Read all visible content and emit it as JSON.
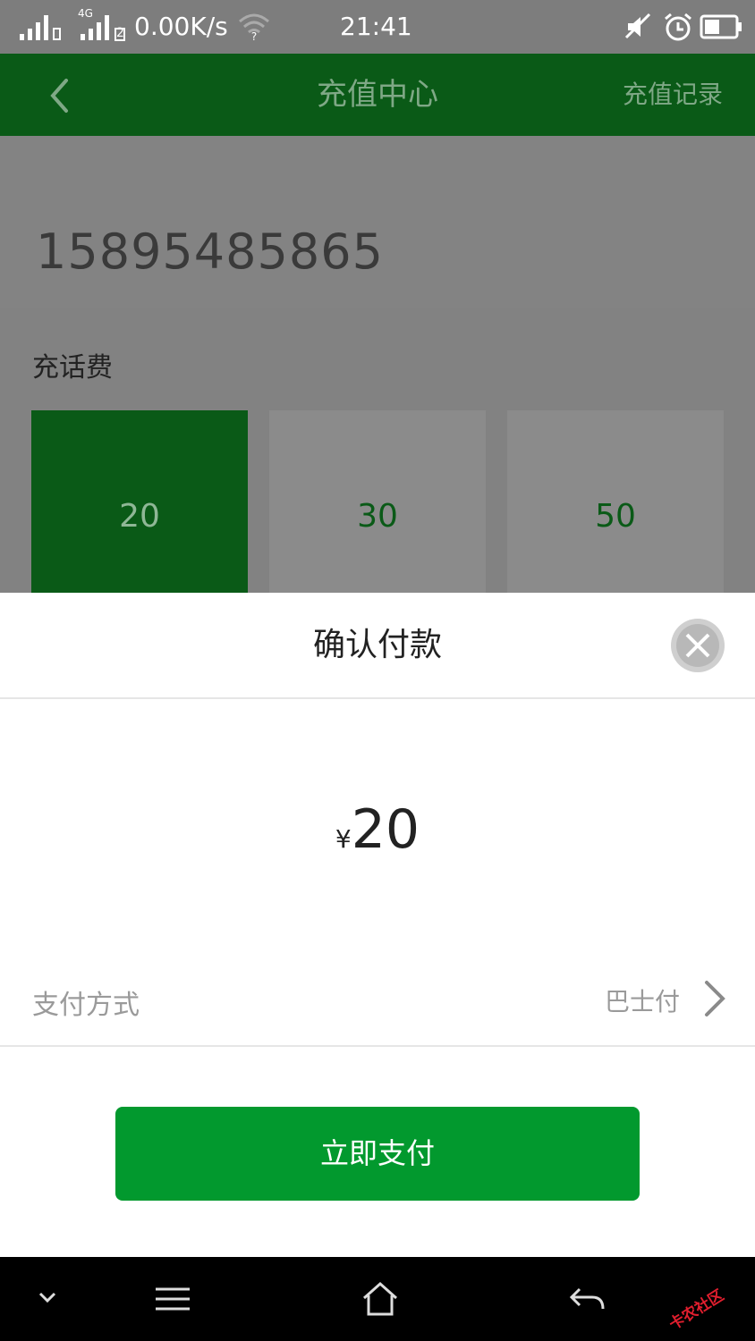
{
  "status_bar": {
    "net_speed": "0.00K/s",
    "time": "21:41",
    "network_type": "4G",
    "sim2_label": "2",
    "icons": [
      "signal-icon",
      "signal-4g-icon",
      "wifi-icon",
      "mute-icon",
      "alarm-icon",
      "battery-icon"
    ]
  },
  "header": {
    "title": "充值中心",
    "right_link": "充值记录",
    "back_icon": "chevron-left-icon",
    "color": "#0a5a17"
  },
  "page": {
    "phone_number": "15895485865",
    "section_label": "充话费",
    "options": [
      {
        "label": "20",
        "selected": true
      },
      {
        "label": "30",
        "selected": false
      },
      {
        "label": "50",
        "selected": false
      }
    ]
  },
  "sheet": {
    "title": "确认付款",
    "close_icon": "close-icon",
    "currency": "¥",
    "amount": "20",
    "pay_method_label": "支付方式",
    "pay_method_value": "巴士付",
    "pay_button": "立即支付",
    "pay_button_color": "#02992e"
  },
  "nav_bar": {
    "icons": [
      "chevron-down-icon",
      "menu-icon",
      "home-icon",
      "back-arrow-icon"
    ],
    "watermark": "卡农社区"
  }
}
